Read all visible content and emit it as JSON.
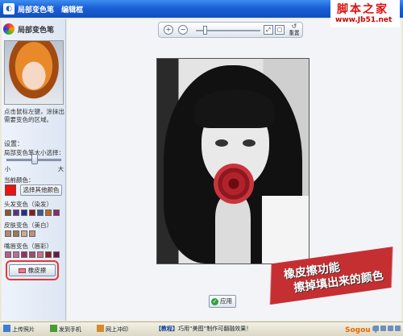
{
  "titlebar": {
    "app_title": "局部变色笔",
    "frame_label": "编辑框"
  },
  "watermark": {
    "title": "脚本之家",
    "url": "www.Jb51.net"
  },
  "left_panel": {
    "header": "局部变色笔",
    "instruction": "点击鼠标左键，涂抹出需要变色的区域。",
    "settings_title": "设置：",
    "brush_size_label": "局部变色笔大小选择：",
    "slider_small": "小",
    "slider_large": "大",
    "slider_level_percent": 52,
    "current_color_label": "当前颜色：",
    "current_color": "#ee1111",
    "choose_other_color_label": "选择其他颜色",
    "hair_label": "头发变色（染发）",
    "hair_swatches": [
      "#8a5a2b",
      "#5a2f8c",
      "#2b2b8a",
      "#8a1a1a",
      "#3a5a9a",
      "#c4681c",
      "#8a2a6a"
    ],
    "skin_label": "皮肤变色（美白）",
    "skin_swatches": [
      "#b08a70",
      "#9c7a5a",
      "#d2a98d",
      "#c09080"
    ],
    "lip_label": "嘴唇变色（唇彩）",
    "lip_swatches": [
      "#b85c8a",
      "#c46a9a",
      "#9a3060",
      "#a34a70",
      "#d66a8a",
      "#8a2020",
      "#6a1a3a"
    ],
    "eraser_label": "橡皮擦"
  },
  "toolbar": {
    "zoom_in_icon": "zoom-in-icon",
    "zoom_out_icon": "zoom-out-icon",
    "zoom_level_percent": 15,
    "reset_label": "重置"
  },
  "caption": {
    "line1": "橡皮擦功能",
    "line2": "擦掉填出来的颜色"
  },
  "actions": {
    "apply_label": "应用"
  },
  "statusbar": {
    "upload_label": "上传照片",
    "phone_label": "发到手机",
    "online_label": "网上冲印",
    "news_tag": "【教程】",
    "news_text": "巧用“美图”制作可翻融效果！",
    "ime_brand": "Sogou",
    "ime_lang": "中"
  }
}
